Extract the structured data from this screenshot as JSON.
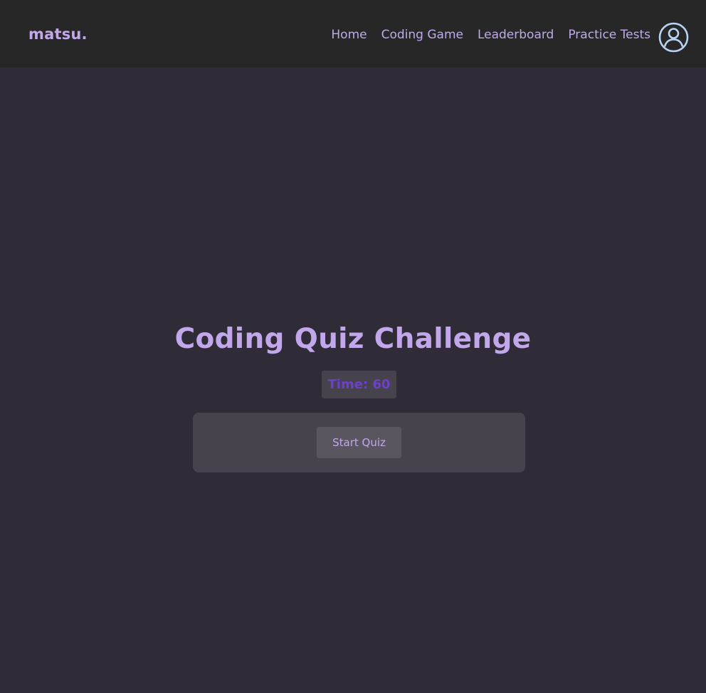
{
  "header": {
    "logo_text": "matsu",
    "logo_dot": ".",
    "nav": [
      {
        "label": "Home"
      },
      {
        "label": "Coding Game"
      },
      {
        "label": "Leaderboard"
      },
      {
        "label": "Practice Tests"
      }
    ],
    "account_icon": "user-circle-icon"
  },
  "quiz": {
    "title": "Coding Quiz Challenge",
    "timer": "Time: 60",
    "start_label": "Start Quiz"
  },
  "colors": {
    "background": "#2f2c37",
    "navbar": "#272727",
    "accent": "#c2a8ea",
    "timer_text": "#6e3fcf",
    "card": "#46434d",
    "button": "#5a5660",
    "icon": "#b8d4f5"
  }
}
